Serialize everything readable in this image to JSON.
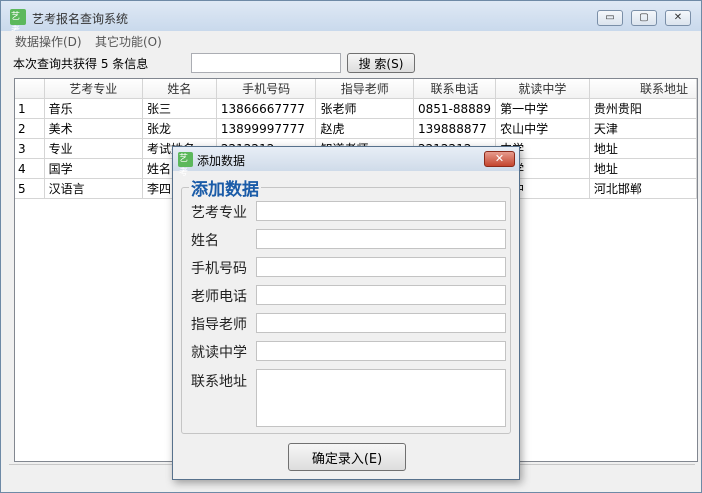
{
  "window": {
    "title": "艺考报名查询系统",
    "icon_text": "艺考",
    "minimize_glyph": "▭",
    "maximize_glyph": "▢",
    "close_glyph": "✕"
  },
  "menu": [
    {
      "label": "数据操作(D)"
    },
    {
      "label": "其它功能(O)"
    }
  ],
  "toolbar": {
    "result_text": "本次查询共获得 5 条信息",
    "search_value": "",
    "search_button": "搜 索(S)"
  },
  "table": {
    "columns": [
      "",
      "艺考专业",
      "姓名",
      "手机号码",
      "指导老师",
      "联系电话",
      "就读中学",
      "联系地址"
    ],
    "rows": [
      {
        "num": "1",
        "major": "音乐",
        "name": "张三",
        "phone": "13866667777",
        "teacher": "张老师",
        "contact": "0851-88889",
        "school": "第一中学",
        "address": "贵州贵阳"
      },
      {
        "num": "2",
        "major": "美术",
        "name": "张龙",
        "phone": "13899997777",
        "teacher": "赵虎",
        "contact": "139888877",
        "school": "农山中学",
        "address": "天津"
      },
      {
        "num": "3",
        "major": "专业",
        "name": "考试姓名",
        "phone": "2212212",
        "teacher": "知道老师",
        "contact": "2212212",
        "school": "中学",
        "address": "地址"
      },
      {
        "num": "4",
        "major": "国学",
        "name": "姓名",
        "phone": "",
        "teacher": "",
        "contact": "",
        "school": "中学",
        "address": "地址"
      },
      {
        "num": "5",
        "major": "汉语言",
        "name": "李四",
        "phone": "",
        "teacher": "",
        "contact": "",
        "school": "一中",
        "address": "河北邯郸"
      }
    ]
  },
  "dialog": {
    "title": "添加数据",
    "icon_text": "艺考",
    "close_glyph": "✕",
    "group_title": "添加数据",
    "fields": [
      {
        "label": "艺考专业",
        "value": ""
      },
      {
        "label": "姓名",
        "value": ""
      },
      {
        "label": "手机号码",
        "value": ""
      },
      {
        "label": "老师电话",
        "value": ""
      },
      {
        "label": "指导老师",
        "value": ""
      },
      {
        "label": "就读中学",
        "value": ""
      },
      {
        "label": "联系地址",
        "value": ""
      }
    ],
    "confirm_button": "确定录入(E)"
  }
}
